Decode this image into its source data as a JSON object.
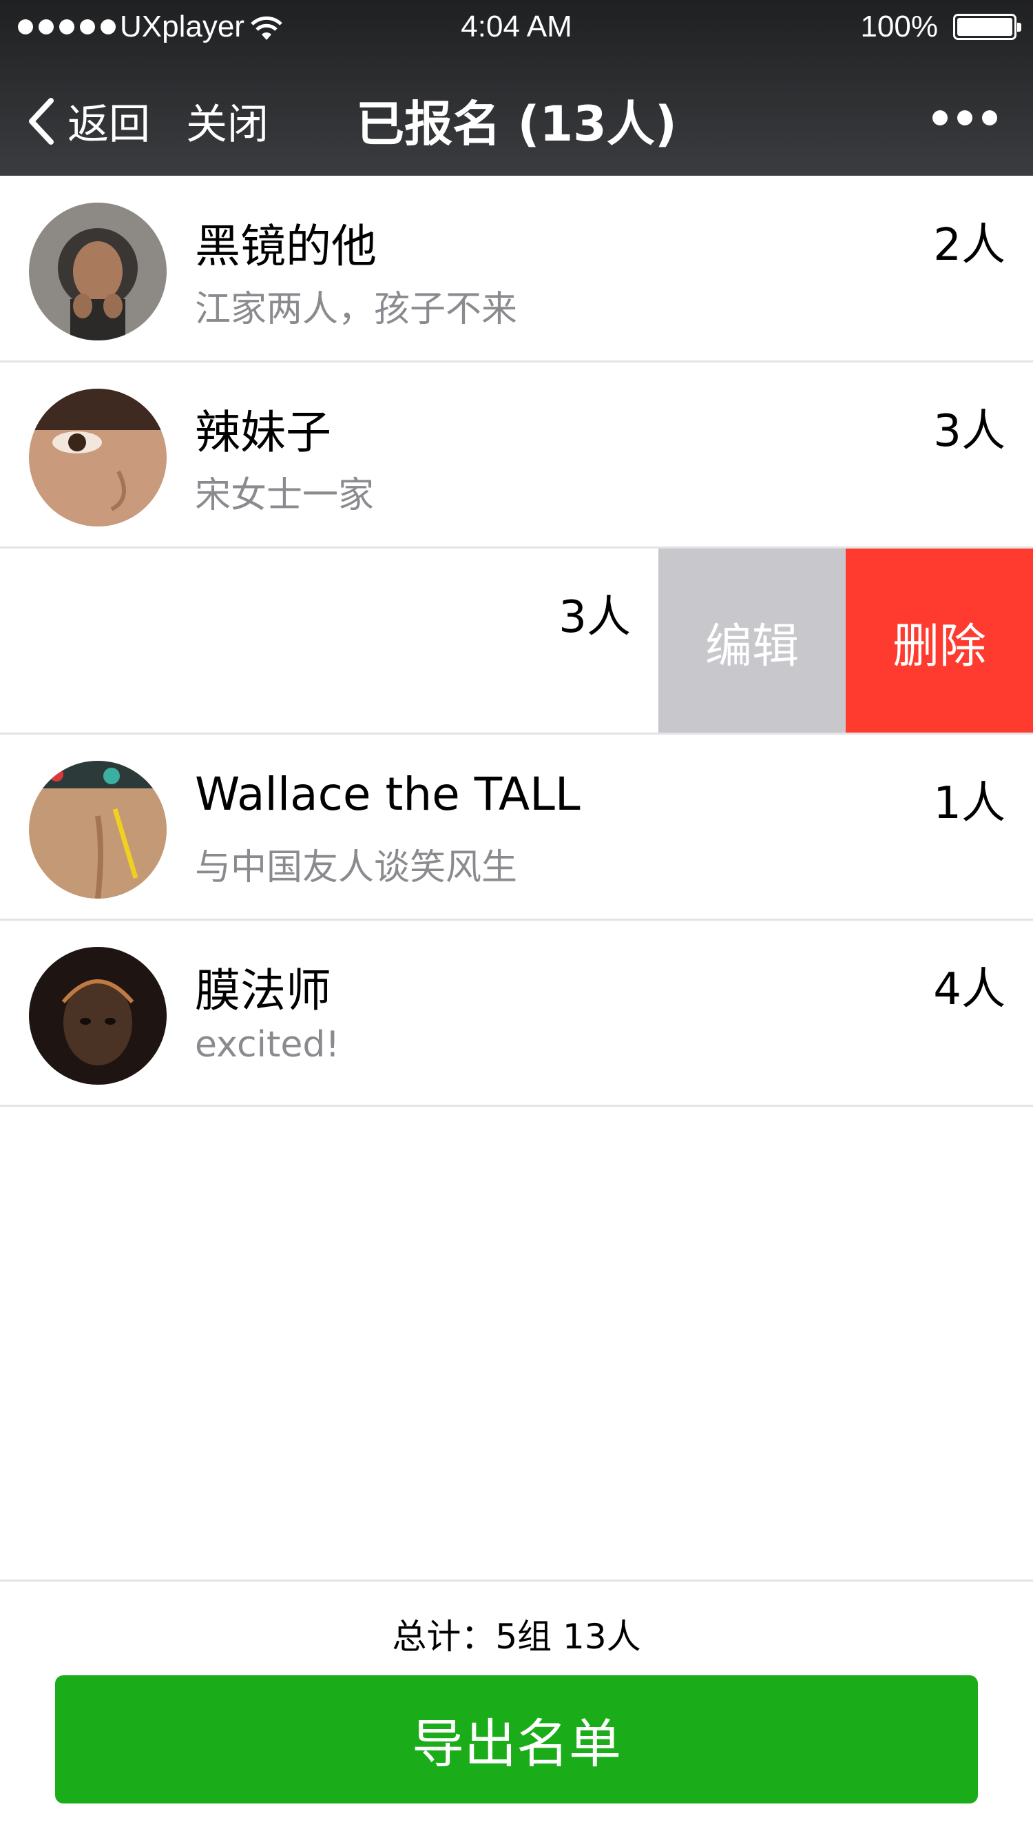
{
  "status_bar": {
    "carrier": "UXplayer",
    "time": "4:04 AM",
    "battery": "100%"
  },
  "nav": {
    "back_label": "返回",
    "close_label": "关闭",
    "title": "已报名 (13人)"
  },
  "entries": [
    {
      "name": "黑镜的他",
      "note": "江家两人，孩子不来",
      "count": "2人",
      "avatar": "hooded-boy-photo"
    },
    {
      "name": "辣妹子",
      "note": "宋女士一家",
      "count": "3人",
      "avatar": "face-closeup-photo"
    },
    {
      "name": "",
      "note": "",
      "count": "3人",
      "avatar": "",
      "swiped": true,
      "actions": {
        "edit": "编辑",
        "delete": "删除"
      }
    },
    {
      "name": "Wallace the TALL",
      "note": "与中国友人谈笑风生",
      "count": "1人",
      "avatar": "back-with-pencil-photo"
    },
    {
      "name": "膜法师",
      "note": "excited!",
      "count": "4人",
      "avatar": "girl-dark-photo"
    }
  ],
  "footer": {
    "total": "总计：5组 13人",
    "export_label": "导出名单"
  },
  "colors": {
    "nav_bg": "#2b2c2e",
    "edit_action": "#c7c7cc",
    "delete_action": "#ff3b30",
    "primary_button": "#1aad19"
  }
}
